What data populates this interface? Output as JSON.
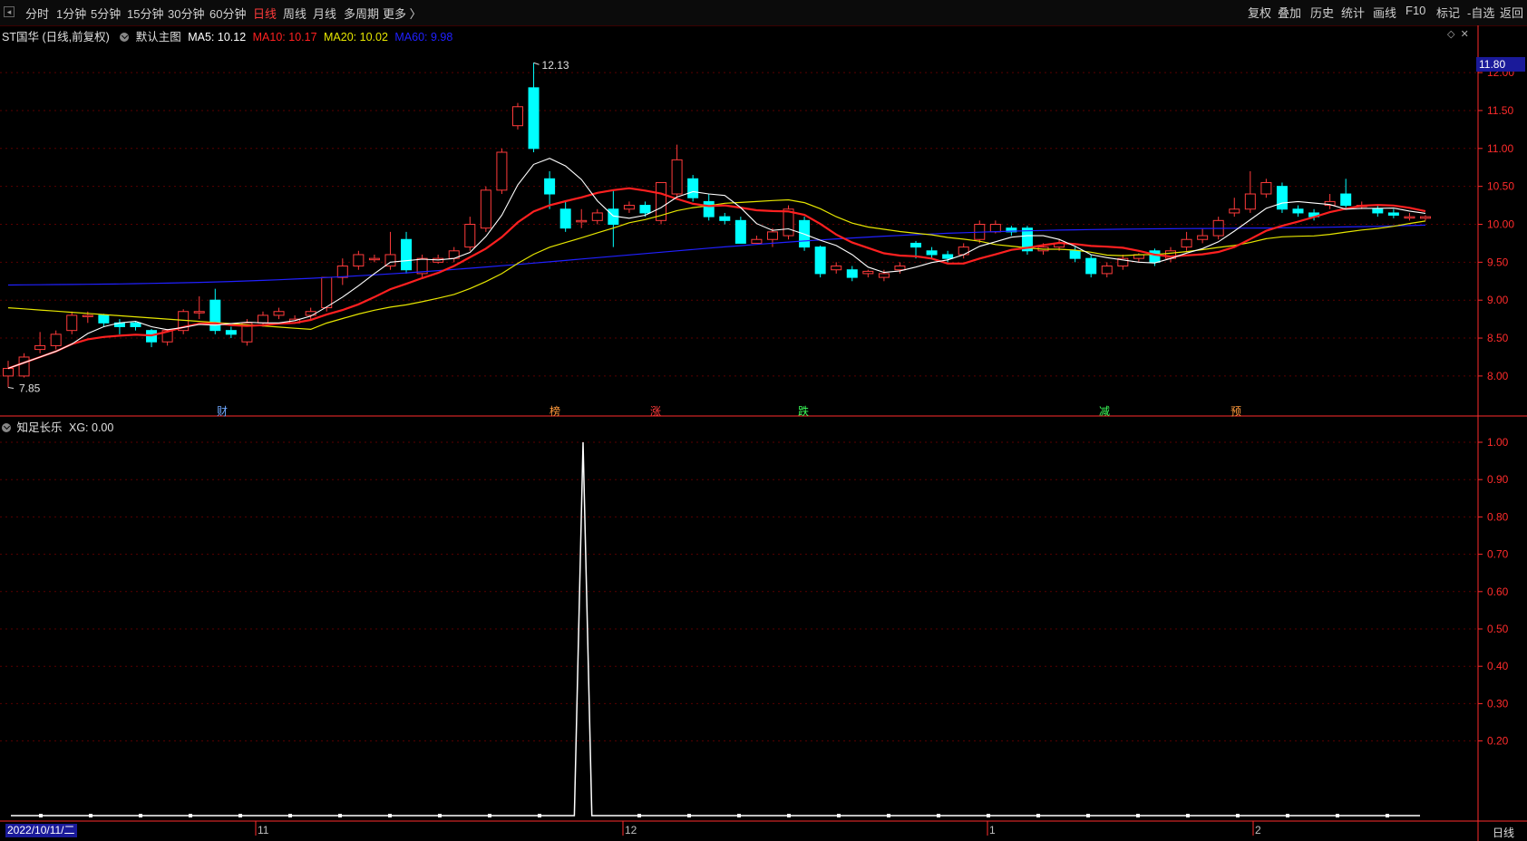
{
  "toolbar": {
    "left": [
      "分时",
      "1分钟",
      "5分钟",
      "15分钟",
      "30分钟",
      "60分钟",
      "日线",
      "周线",
      "月线",
      "多周期",
      "更多 〉"
    ],
    "active": "日线",
    "right": [
      "复权",
      "叠加",
      "历史",
      "统计",
      "画线",
      "F10",
      "标记",
      "-自选",
      "返回"
    ]
  },
  "main_info": {
    "stock": "ST国华 (日线,前复权)",
    "template": "默认主图",
    "ma5": "MA5: 10.12",
    "ma10": "MA10: 10.17",
    "ma20": "MA20: 10.02",
    "ma60": "MA60: 9.98"
  },
  "indicator_info": {
    "name": "知足长乐",
    "value": "XG: 0.00"
  },
  "price_tag": "11.80",
  "period_tag": "日线",
  "events": [
    {
      "label": "财",
      "color": "#6fa8ff"
    },
    {
      "label": "榜",
      "color": "#ff9a3c"
    },
    {
      "label": "涨",
      "color": "#ff3b3b"
    },
    {
      "label": "跌",
      "color": "#3bff5a"
    },
    {
      "label": "减",
      "color": "#3bff5a"
    },
    {
      "label": "预",
      "color": "#ff9a3c"
    }
  ],
  "date_axis": {
    "start": "2022/10/11/二",
    "months": [
      "11",
      "12",
      "1",
      "2"
    ]
  },
  "colors": {
    "up": "#ff3b3b",
    "down": "#00ffff",
    "ma5": "#ffffff",
    "ma10": "#ff2020",
    "ma20": "#e6e600",
    "ma60": "#2020ff",
    "axis": "#ff2b2b",
    "grid": "#5a0000"
  },
  "chart_data": [
    {
      "type": "candlestick",
      "title": "ST国华 (日线,前复权)",
      "ylim": [
        7.7,
        12.3
      ],
      "y_ticks": [
        8.0,
        8.5,
        9.0,
        9.5,
        10.0,
        10.5,
        11.0,
        11.5,
        12.0
      ],
      "high_label": "12.13",
      "low_label": "7.85",
      "candles": [
        [
          8.0,
          8.1,
          7.85,
          8.2
        ],
        [
          8.0,
          8.25,
          7.98,
          8.3
        ],
        [
          8.35,
          8.4,
          8.3,
          8.58
        ],
        [
          8.4,
          8.55,
          8.35,
          8.6
        ],
        [
          8.6,
          8.8,
          8.55,
          8.85
        ],
        [
          8.8,
          8.8,
          8.7,
          8.85
        ],
        [
          8.8,
          8.7,
          8.65,
          8.82
        ],
        [
          8.7,
          8.65,
          8.55,
          8.75
        ],
        [
          8.7,
          8.65,
          8.6,
          8.72
        ],
        [
          8.6,
          8.45,
          8.38,
          8.62
        ],
        [
          8.45,
          8.6,
          8.4,
          8.62
        ],
        [
          8.6,
          8.85,
          8.55,
          8.88
        ],
        [
          8.85,
          8.85,
          8.75,
          9.05
        ],
        [
          9.0,
          8.6,
          8.55,
          9.15
        ],
        [
          8.6,
          8.55,
          8.5,
          8.65
        ],
        [
          8.45,
          8.7,
          8.4,
          8.75
        ],
        [
          8.7,
          8.8,
          8.65,
          8.85
        ],
        [
          8.8,
          8.85,
          8.75,
          8.9
        ],
        [
          8.7,
          8.75,
          8.7,
          8.8
        ],
        [
          8.8,
          8.85,
          8.75,
          8.9
        ],
        [
          8.9,
          9.3,
          8.85,
          9.3
        ],
        [
          9.3,
          9.45,
          9.2,
          9.55
        ],
        [
          9.45,
          9.6,
          9.4,
          9.65
        ],
        [
          9.55,
          9.55,
          9.5,
          9.6
        ],
        [
          9.45,
          9.6,
          9.4,
          9.9
        ],
        [
          9.8,
          9.4,
          9.35,
          9.9
        ],
        [
          9.35,
          9.55,
          9.3,
          9.6
        ],
        [
          9.5,
          9.55,
          9.48,
          9.6
        ],
        [
          9.55,
          9.65,
          9.5,
          9.7
        ],
        [
          9.7,
          10.0,
          9.65,
          10.1
        ],
        [
          9.95,
          10.45,
          9.9,
          10.5
        ],
        [
          10.45,
          10.95,
          10.4,
          11.0
        ],
        [
          11.3,
          11.55,
          11.25,
          11.6
        ],
        [
          11.8,
          11.0,
          10.95,
          12.13
        ],
        [
          10.6,
          10.4,
          10.2,
          10.7
        ],
        [
          10.2,
          9.95,
          9.9,
          10.3
        ],
        [
          10.05,
          10.05,
          9.95,
          10.2
        ],
        [
          10.05,
          10.15,
          10.0,
          10.2
        ],
        [
          10.2,
          10.0,
          9.7,
          10.45
        ],
        [
          10.2,
          10.25,
          10.15,
          10.3
        ],
        [
          10.25,
          10.15,
          10.1,
          10.3
        ],
        [
          10.05,
          10.55,
          10.0,
          10.55
        ],
        [
          10.4,
          10.85,
          10.35,
          11.05
        ],
        [
          10.6,
          10.35,
          10.3,
          10.65
        ],
        [
          10.3,
          10.1,
          10.05,
          10.4
        ],
        [
          10.1,
          10.05,
          10.0,
          10.15
        ],
        [
          10.05,
          9.75,
          9.75,
          10.1
        ],
        [
          9.75,
          9.8,
          9.75,
          9.85
        ],
        [
          9.8,
          9.9,
          9.7,
          9.95
        ],
        [
          9.85,
          10.2,
          9.8,
          10.25
        ],
        [
          10.05,
          9.7,
          9.65,
          10.1
        ],
        [
          9.7,
          9.35,
          9.3,
          9.72
        ],
        [
          9.4,
          9.45,
          9.35,
          9.5
        ],
        [
          9.4,
          9.3,
          9.25,
          9.45
        ],
        [
          9.35,
          9.38,
          9.3,
          9.4
        ],
        [
          9.3,
          9.35,
          9.25,
          9.4
        ],
        [
          9.4,
          9.45,
          9.35,
          9.5
        ],
        [
          9.75,
          9.7,
          9.55,
          9.78
        ],
        [
          9.65,
          9.6,
          9.55,
          9.7
        ],
        [
          9.6,
          9.55,
          9.5,
          9.65
        ],
        [
          9.6,
          9.7,
          9.55,
          9.75
        ],
        [
          9.8,
          10.0,
          9.75,
          10.05
        ],
        [
          9.9,
          10.0,
          9.88,
          10.05
        ],
        [
          9.95,
          9.9,
          9.85,
          9.98
        ],
        [
          9.95,
          9.65,
          9.6,
          9.98
        ],
        [
          9.65,
          9.7,
          9.6,
          9.75
        ],
        [
          9.7,
          9.75,
          9.65,
          9.8
        ],
        [
          9.65,
          9.55,
          9.5,
          9.7
        ],
        [
          9.55,
          9.35,
          9.3,
          9.6
        ],
        [
          9.35,
          9.45,
          9.3,
          9.5
        ],
        [
          9.45,
          9.55,
          9.4,
          9.6
        ],
        [
          9.55,
          9.6,
          9.5,
          9.62
        ],
        [
          9.65,
          9.5,
          9.45,
          9.68
        ],
        [
          9.55,
          9.65,
          9.5,
          9.7
        ],
        [
          9.7,
          9.8,
          9.65,
          9.9
        ],
        [
          9.8,
          9.85,
          9.75,
          9.95
        ],
        [
          9.85,
          10.05,
          9.8,
          10.1
        ],
        [
          10.15,
          10.2,
          10.1,
          10.35
        ],
        [
          10.2,
          10.4,
          10.15,
          10.7
        ],
        [
          10.4,
          10.55,
          10.35,
          10.6
        ],
        [
          10.5,
          10.2,
          10.15,
          10.55
        ],
        [
          10.2,
          10.15,
          10.1,
          10.25
        ],
        [
          10.15,
          10.1,
          10.05,
          10.2
        ],
        [
          10.25,
          10.3,
          10.2,
          10.4
        ],
        [
          10.4,
          10.25,
          10.2,
          10.6
        ],
        [
          10.25,
          10.25,
          10.2,
          10.3
        ],
        [
          10.2,
          10.15,
          10.1,
          10.25
        ],
        [
          10.15,
          10.12,
          10.08,
          10.2
        ],
        [
          10.1,
          10.1,
          10.05,
          10.15
        ],
        [
          10.08,
          10.1,
          10.05,
          10.12
        ]
      ]
    },
    {
      "type": "line",
      "title": "知足长乐",
      "ylim": [
        0,
        1.0
      ],
      "y_ticks": [
        0.2,
        0.3,
        0.4,
        0.5,
        0.6,
        0.7,
        0.8,
        0.9,
        1.0
      ],
      "series": [
        {
          "name": "XG",
          "spike_index": 36,
          "baseline": 0,
          "peak": 1.0
        }
      ]
    }
  ]
}
